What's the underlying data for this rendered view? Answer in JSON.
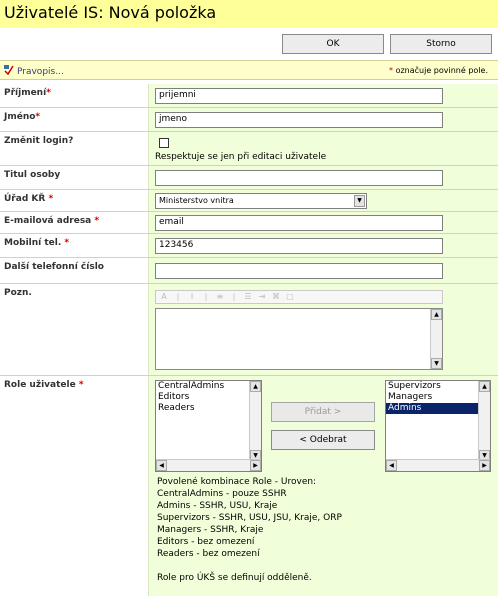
{
  "title": "Uživatelé IS: Nová položka",
  "buttons": {
    "ok": "OK",
    "cancel": "Storno"
  },
  "toolbar": {
    "spelling": "Pravopis...",
    "required_star": "*",
    "required_note": " označuje povinné pole."
  },
  "fields": {
    "surname": {
      "label": "Příjmení",
      "value": "prijemni"
    },
    "name": {
      "label": "Jméno",
      "value": "jmeno"
    },
    "change_login": {
      "label": "Změnit login?",
      "note": "Respektuje se jen při editaci uživatele"
    },
    "title": {
      "label": "Titul osoby",
      "value": ""
    },
    "office": {
      "label": "Úřad KŘ",
      "value": "Ministerstvo vnitra"
    },
    "email": {
      "label": "E-mailová adresa",
      "value": "email"
    },
    "mobile": {
      "label": "Mobilní tel.",
      "value": "123456"
    },
    "phone": {
      "label": "Další telefonní číslo",
      "value": ""
    },
    "note": {
      "label": "Pozn."
    },
    "roles": {
      "label": "Role uživatele",
      "available": [
        "CentralAdmins",
        "Editors",
        "Readers"
      ],
      "selected": [
        "Supervizors",
        "Managers",
        "Admins"
      ],
      "selected_highlight": "Admins",
      "add_button": "Přidat >",
      "remove_button": "< Odebrat",
      "info": [
        "Povolené kombinace Role - Uroven:",
        "CentralAdmins - pouze SSHR",
        "Admins - SSHR, USU, Kraje",
        "Supervizors - SSHR, USU, JSU, Kraje, ORP",
        "Managers - SSHR, Kraje",
        "Editors - bez omezení",
        "Readers - bez omezení",
        "",
        "Role pro ÚKŠ se definují odděleně."
      ]
    }
  },
  "colors": {
    "title_bg": "#ffff99",
    "field_bg": "#f0ffd9",
    "required": "#cc0000",
    "selection": "#0a246a"
  },
  "icons": {
    "spelling": "spellcheck-icon",
    "dropdown": "chevron-down-icon"
  }
}
